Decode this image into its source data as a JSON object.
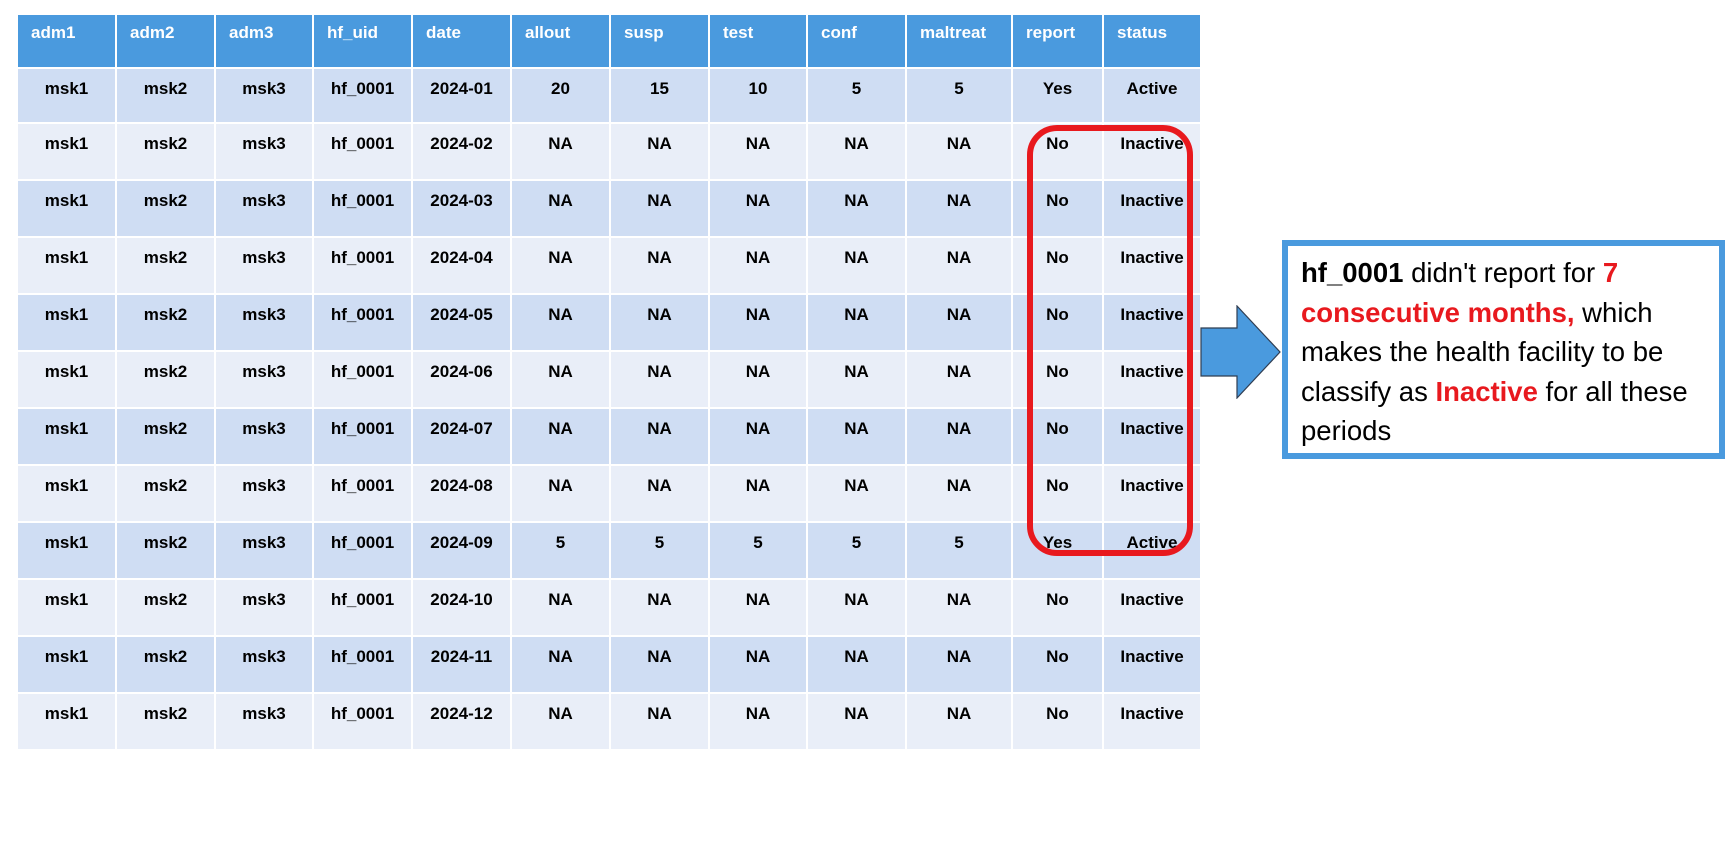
{
  "table": {
    "columns": [
      "adm1",
      "adm2",
      "adm3",
      "hf_uid",
      "date",
      "allout",
      "susp",
      "test",
      "conf",
      "maltreat",
      "report",
      "status"
    ],
    "rows": [
      [
        "msk1",
        "msk2",
        "msk3",
        "hf_0001",
        "2024-01",
        "20",
        "15",
        "10",
        "5",
        "5",
        "Yes",
        "Active"
      ],
      [
        "msk1",
        "msk2",
        "msk3",
        "hf_0001",
        "2024-02",
        "NA",
        "NA",
        "NA",
        "NA",
        "NA",
        "No",
        "Inactive"
      ],
      [
        "msk1",
        "msk2",
        "msk3",
        "hf_0001",
        "2024-03",
        "NA",
        "NA",
        "NA",
        "NA",
        "NA",
        "No",
        "Inactive"
      ],
      [
        "msk1",
        "msk2",
        "msk3",
        "hf_0001",
        "2024-04",
        "NA",
        "NA",
        "NA",
        "NA",
        "NA",
        "No",
        "Inactive"
      ],
      [
        "msk1",
        "msk2",
        "msk3",
        "hf_0001",
        "2024-05",
        "NA",
        "NA",
        "NA",
        "NA",
        "NA",
        "No",
        "Inactive"
      ],
      [
        "msk1",
        "msk2",
        "msk3",
        "hf_0001",
        "2024-06",
        "NA",
        "NA",
        "NA",
        "NA",
        "NA",
        "No",
        "Inactive"
      ],
      [
        "msk1",
        "msk2",
        "msk3",
        "hf_0001",
        "2024-07",
        "NA",
        "NA",
        "NA",
        "NA",
        "NA",
        "No",
        "Inactive"
      ],
      [
        "msk1",
        "msk2",
        "msk3",
        "hf_0001",
        "2024-08",
        "NA",
        "NA",
        "NA",
        "NA",
        "NA",
        "No",
        "Inactive"
      ],
      [
        "msk1",
        "msk2",
        "msk3",
        "hf_0001",
        "2024-09",
        "5",
        "5",
        "5",
        "5",
        "5",
        "Yes",
        "Active"
      ],
      [
        "msk1",
        "msk2",
        "msk3",
        "hf_0001",
        "2024-10",
        "NA",
        "NA",
        "NA",
        "NA",
        "NA",
        "No",
        "Inactive"
      ],
      [
        "msk1",
        "msk2",
        "msk3",
        "hf_0001",
        "2024-11",
        "NA",
        "NA",
        "NA",
        "NA",
        "NA",
        "No",
        "Inactive"
      ],
      [
        "msk1",
        "msk2",
        "msk3",
        "hf_0001",
        "2024-12",
        "NA",
        "NA",
        "NA",
        "NA",
        "NA",
        "No",
        "Inactive"
      ]
    ]
  },
  "callout": {
    "facility": "hf_0001",
    "text1": " didn't report for ",
    "months_count": "7",
    "months_phrase": "consecutive months,",
    "text2": " which makes the health facility to be classify as ",
    "status_word": "Inactive",
    "text3": " for all these periods"
  },
  "colors": {
    "header_bg": "#4a9ade",
    "row_odd_bg": "#cfddf3",
    "row_even_bg": "#e9eef8",
    "highlight_red": "#e8191e",
    "arrow_blue": "#4a9ade"
  },
  "icons": {
    "arrow": "right-arrow-icon"
  }
}
